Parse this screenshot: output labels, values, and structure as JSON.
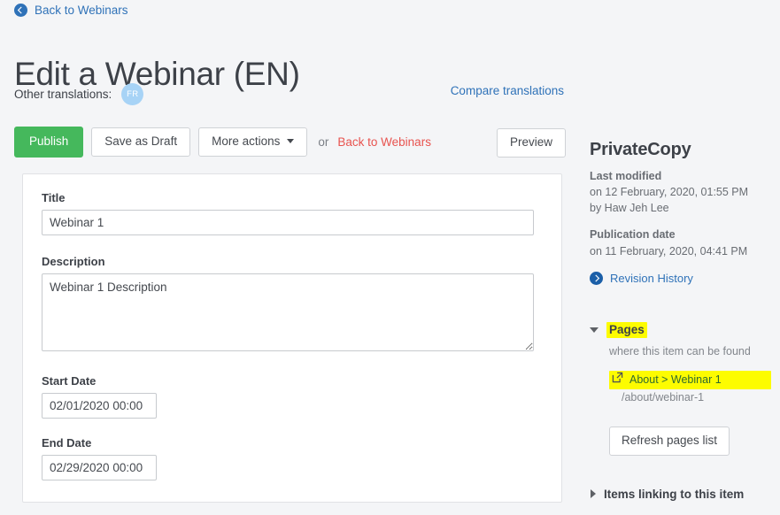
{
  "back_nav": {
    "icon": "arrow-circle-left-icon",
    "label": "Back to Webinars"
  },
  "header": {
    "title": "Edit a Webinar (EN)",
    "translations_label": "Other translations:",
    "translation_badge": "FR",
    "compare_link": "Compare translations"
  },
  "toolbar": {
    "publish_label": "Publish",
    "save_draft_label": "Save as Draft",
    "more_actions_label": "More actions",
    "or_text": "or",
    "back_link_label": "Back to Webinars",
    "preview_label": "Preview"
  },
  "form": {
    "title": {
      "label": "Title",
      "value": "Webinar 1",
      "placeholder": ""
    },
    "description": {
      "label": "Description",
      "value": "Webinar 1 Description",
      "placeholder": ""
    },
    "start_date": {
      "label": "Start Date",
      "value": "02/01/2020 00:00",
      "placeholder": ""
    },
    "end_date": {
      "label": "End Date",
      "value": "02/29/2020 00:00",
      "placeholder": ""
    }
  },
  "sidebar": {
    "title": "PrivateCopy",
    "last_modified": {
      "heading": "Last modified",
      "date_line": "on 12 February, 2020, 01:55 PM",
      "author_line": "by Haw Jeh Lee"
    },
    "publication": {
      "heading": "Publication date",
      "date_line": "on 11 February, 2020, 04:41 PM"
    },
    "revision_history": {
      "icon": "arrow-circle-right-icon",
      "label": "Revision History"
    },
    "pages_section": {
      "caret": "chevron-down-icon",
      "title": "Pages",
      "subtitle": "where this item can be found",
      "entry": {
        "icon": "external-link-icon",
        "label": "About > Webinar 1",
        "path": "/about/webinar-1"
      },
      "refresh_label": "Refresh pages list"
    },
    "links_section": {
      "caret": "chevron-right-icon",
      "title": "Items linking to this item"
    }
  },
  "colors": {
    "page_background": "#f4f5f7",
    "publish_green": "#45b85c",
    "link_blue": "#2f72b8",
    "danger_red": "#e8534f",
    "highlight_yellow": "#fdfc00",
    "avatar_blue": "#a7d3f6",
    "page_link_green": "#2f6a2f"
  }
}
